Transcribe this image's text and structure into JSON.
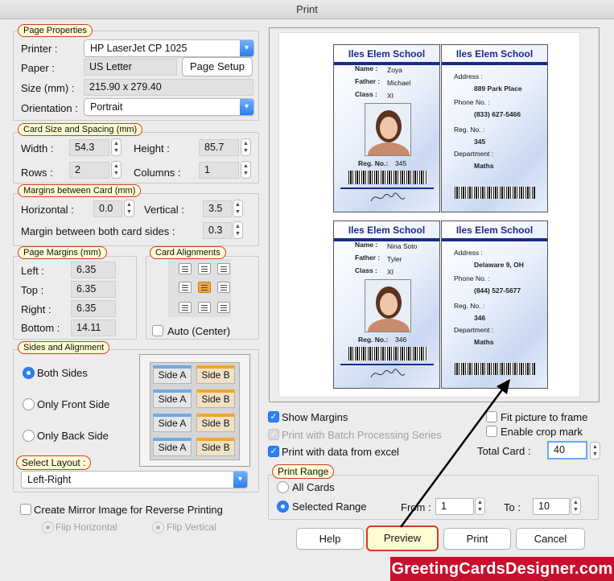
{
  "window": {
    "title": "Print"
  },
  "page_properties": {
    "legend": "Page Properties",
    "printer_label": "Printer :",
    "printer_value": "HP LaserJet CP 1025",
    "paper_label": "Paper :",
    "paper_value": "US Letter",
    "page_setup_button": "Page Setup",
    "size_label": "Size (mm) :",
    "size_value": "215.90 x 279.40",
    "orientation_label": "Orientation :",
    "orientation_value": "Portrait"
  },
  "card_size": {
    "legend": "Card Size and Spacing (mm)",
    "width_label": "Width :",
    "width_value": "54.3",
    "height_label": "Height :",
    "height_value": "85.7",
    "rows_label": "Rows :",
    "rows_value": "2",
    "columns_label": "Columns :",
    "columns_value": "1"
  },
  "margins_between": {
    "legend": "Margins between Card (mm)",
    "horizontal_label": "Horizontal :",
    "horizontal_value": "0.0",
    "vertical_label": "Vertical :",
    "vertical_value": "3.5",
    "both_sides_label": "Margin between both card sides :",
    "both_sides_value": "0.3"
  },
  "page_margins": {
    "legend": "Page Margins (mm)",
    "left_label": "Left :",
    "left_value": "6.35",
    "top_label": "Top :",
    "top_value": "6.35",
    "right_label": "Right :",
    "right_value": "6.35",
    "bottom_label": "Bottom :",
    "bottom_value": "14.11"
  },
  "card_alignments": {
    "legend": "Card Alignments",
    "auto_center_label": "Auto (Center)",
    "selected": "middle-center"
  },
  "sides": {
    "legend": "Sides and Alignment",
    "both_sides": "Both Sides",
    "front_only": "Only Front Side",
    "back_only": "Only Back Side",
    "selected": "both",
    "side_a": "Side A",
    "side_b": "Side B"
  },
  "layout": {
    "legend": "Select Layout :",
    "value": "Left-Right"
  },
  "mirror": {
    "label": "Create Mirror Image for Reverse Printing",
    "flip_horizontal": "Flip Horizontal",
    "flip_vertical": "Flip Vertical"
  },
  "preview_options": {
    "show_margins": "Show Margins",
    "batch_series": "Print with Batch Processing Series",
    "excel_data": "Print with data from excel",
    "fit_frame": "Fit picture to frame",
    "crop_mark": "Enable crop mark",
    "total_card_label": "Total Card :",
    "total_card_value": "40"
  },
  "print_range": {
    "legend": "Print Range",
    "all_cards": "All Cards",
    "selected_range": "Selected Range",
    "from_label": "From :",
    "from_value": "1",
    "to_label": "To :",
    "to_value": "10"
  },
  "buttons": {
    "help": "Help",
    "preview": "Preview",
    "print": "Print",
    "cancel": "Cancel"
  },
  "watermark": "GreetingCardsDesigner.com",
  "cards": [
    {
      "school": "Iles Elem School",
      "name_label": "Name :",
      "name": "Zoya",
      "father_label": "Father :",
      "father": "Michael",
      "class_label": "Class :",
      "class": "XI",
      "reg_label": "Reg. No.:",
      "reg": "345",
      "address_label": "Address :",
      "address": "889 Park Place",
      "phone_label": "Phone No. :",
      "phone": "(833) 627-5466",
      "back_reg_label": "Reg. No. :",
      "back_reg": "345",
      "dept_label": "Department :",
      "dept": "Maths"
    },
    {
      "school": "Iles Elem School",
      "name_label": "Name :",
      "name": "Nina Soto",
      "father_label": "Father :",
      "father": "Tyler",
      "class_label": "Class :",
      "class": "XI",
      "reg_label": "Reg. No.:",
      "reg": "346",
      "address_label": "Address :",
      "address": "Delaware 9, OH",
      "phone_label": "Phone No. :",
      "phone": "(844) 527-5677",
      "back_reg_label": "Reg. No. :",
      "back_reg": "346",
      "dept_label": "Department :",
      "dept": "Maths"
    }
  ],
  "colors": {
    "accent": "#2c80f2",
    "legend_border": "#d63b2b",
    "legend_bg": "#fdfbd2",
    "card_blue": "#1b2a8a",
    "watermark_bg": "#c8102e"
  }
}
